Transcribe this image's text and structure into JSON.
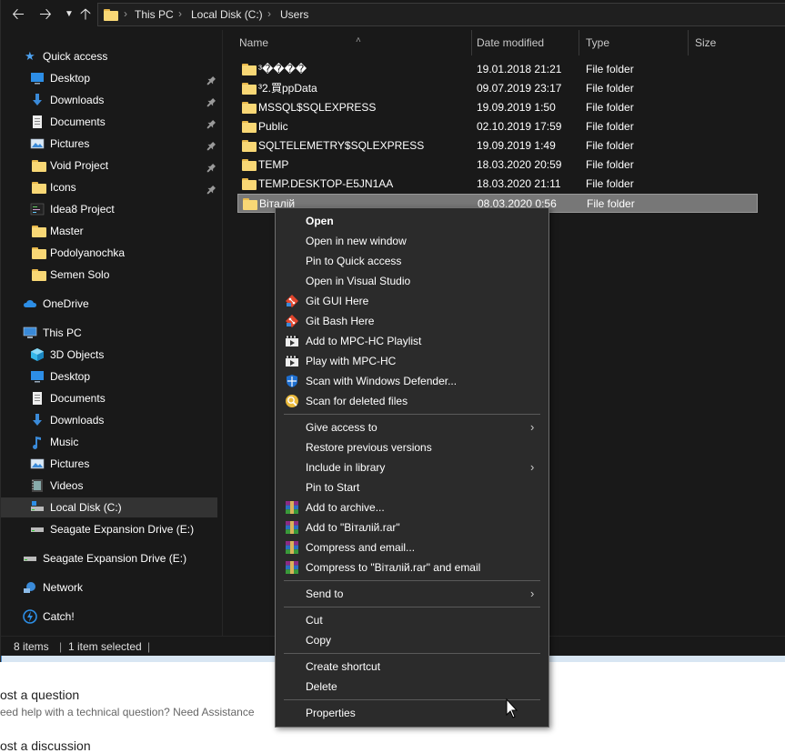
{
  "address": {
    "crumbs": [
      "This PC",
      "Local Disk (C:)",
      "Users"
    ]
  },
  "sidebar": {
    "quick_access": "Quick access",
    "quick_items": [
      {
        "label": "Desktop",
        "icon": "desktop-icon",
        "pinned": true
      },
      {
        "label": "Downloads",
        "icon": "download-arrow-icon",
        "pinned": true
      },
      {
        "label": "Documents",
        "icon": "document-icon",
        "pinned": true
      },
      {
        "label": "Pictures",
        "icon": "pictures-icon",
        "pinned": true
      },
      {
        "label": "Void Project",
        "icon": "folder-icon",
        "pinned": true
      },
      {
        "label": "Icons",
        "icon": "folder-icon",
        "pinned": true
      },
      {
        "label": "Idea8 Project",
        "icon": "project-icon",
        "pinned": false
      },
      {
        "label": "Master",
        "icon": "folder-icon",
        "pinned": false
      },
      {
        "label": "Podolyanochka",
        "icon": "folder-icon",
        "pinned": false
      },
      {
        "label": "Semen Solo",
        "icon": "folder-icon",
        "pinned": false
      }
    ],
    "onedrive": "OneDrive",
    "this_pc": "This PC",
    "pc_items": [
      {
        "label": "3D Objects",
        "icon": "cube-icon"
      },
      {
        "label": "Desktop",
        "icon": "desktop-icon"
      },
      {
        "label": "Documents",
        "icon": "document-icon"
      },
      {
        "label": "Downloads",
        "icon": "download-arrow-icon"
      },
      {
        "label": "Music",
        "icon": "music-note-icon"
      },
      {
        "label": "Pictures",
        "icon": "pictures-icon"
      },
      {
        "label": "Videos",
        "icon": "film-icon"
      },
      {
        "label": "Local Disk (C:)",
        "icon": "drive-icon"
      },
      {
        "label": "Seagate Expansion Drive (E:)",
        "icon": "external-drive-icon"
      }
    ],
    "seagate": "Seagate Expansion Drive (E:)",
    "network": "Network",
    "catch": "Catch!"
  },
  "columns": {
    "name": "Name",
    "date": "Date modified",
    "type": "Type",
    "size": "Size"
  },
  "files": [
    {
      "name": "³����",
      "date": "19.01.2018 21:21",
      "type": "File folder"
    },
    {
      "name": "³2.買ppData",
      "date": "09.07.2019 23:17",
      "type": "File folder"
    },
    {
      "name": "MSSQL$SQLEXPRESS",
      "date": "19.09.2019 1:50",
      "type": "File folder"
    },
    {
      "name": "Public",
      "date": "02.10.2019 17:59",
      "type": "File folder"
    },
    {
      "name": "SQLTELEMETRY$SQLEXPRESS",
      "date": "19.09.2019 1:49",
      "type": "File folder"
    },
    {
      "name": "TEMP",
      "date": "18.03.2020 20:59",
      "type": "File folder"
    },
    {
      "name": "TEMP.DESKTOP-E5JN1AA",
      "date": "18.03.2020 21:11",
      "type": "File folder"
    },
    {
      "name": "Віталій",
      "date": "08.03.2020 0:56",
      "type": "File folder"
    }
  ],
  "status": {
    "items": "8 items",
    "selected": "1 item selected"
  },
  "web": {
    "q_title": "ost a question",
    "q_sub": "eed help with a technical question? Need Assistance",
    "d_title": "ost a discussion"
  },
  "context_menu": {
    "group1": [
      {
        "label": "Open",
        "icon": "",
        "bold": true
      },
      {
        "label": "Open in new window",
        "icon": ""
      },
      {
        "label": "Pin to Quick access",
        "icon": ""
      },
      {
        "label": "Open in Visual Studio",
        "icon": ""
      },
      {
        "label": "Git GUI Here",
        "icon": "git-icon"
      },
      {
        "label": "Git Bash Here",
        "icon": "git-icon"
      },
      {
        "label": "Add to MPC-HC Playlist",
        "icon": "mpc-hc-icon"
      },
      {
        "label": "Play with MPC-HC",
        "icon": "mpc-hc-icon"
      },
      {
        "label": "Scan with Windows Defender...",
        "icon": "defender-shield-icon"
      },
      {
        "label": "Scan for deleted files",
        "icon": "recovery-icon"
      }
    ],
    "group2": [
      {
        "label": "Give access to",
        "icon": "",
        "submenu": true
      },
      {
        "label": "Restore previous versions",
        "icon": ""
      },
      {
        "label": "Include in library",
        "icon": "",
        "submenu": true
      },
      {
        "label": "Pin to Start",
        "icon": ""
      },
      {
        "label": "Add to archive...",
        "icon": "winrar-icon"
      },
      {
        "label": "Add to \"Віталій.rar\"",
        "icon": "winrar-icon"
      },
      {
        "label": "Compress and email...",
        "icon": "winrar-icon"
      },
      {
        "label": "Compress to \"Віталій.rar\" and email",
        "icon": "winrar-icon"
      }
    ],
    "group3": [
      {
        "label": "Send to",
        "icon": "",
        "submenu": true
      }
    ],
    "group4": [
      {
        "label": "Cut",
        "icon": ""
      },
      {
        "label": "Copy",
        "icon": ""
      }
    ],
    "group5": [
      {
        "label": "Create shortcut",
        "icon": ""
      },
      {
        "label": "Delete",
        "icon": ""
      }
    ],
    "group6": [
      {
        "label": "Properties",
        "icon": ""
      }
    ]
  },
  "colors": {
    "bg": "#191919",
    "menu_bg": "#2b2b2b",
    "folder": "#f8d775",
    "accent_blue": "#1e90ff",
    "selected_row": "#777777"
  }
}
